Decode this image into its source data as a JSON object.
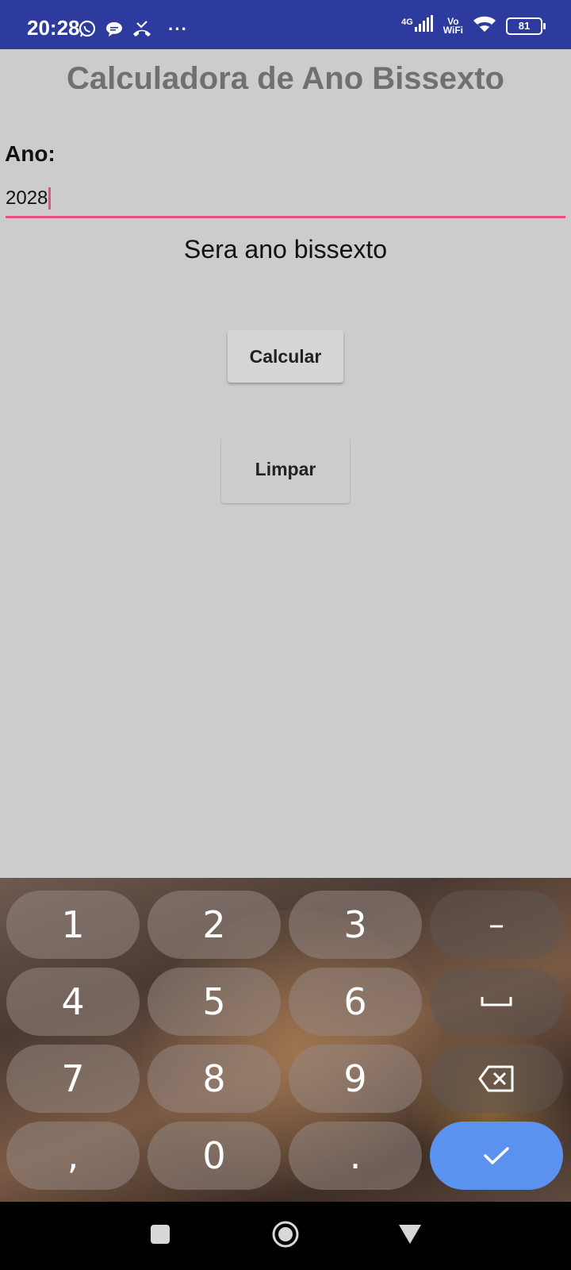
{
  "status_bar": {
    "time": "20:28",
    "network": "4G",
    "vowifi_top": "Vo",
    "vowifi_bottom": "WiFi",
    "battery": "81",
    "more": "···",
    "icons": [
      "whatsapp-icon",
      "chat-bubble-icon",
      "missed-call-icon",
      "signal-icon",
      "wifi-icon",
      "battery-icon"
    ]
  },
  "app": {
    "title": "Calculadora de Ano Bissexto",
    "year_label": "Ano:",
    "year_value": "2028",
    "result": "Sera ano bissexto",
    "calculate_label": "Calcular",
    "clear_label": "Limpar",
    "accent_color": "#e94f86"
  },
  "keyboard": {
    "rows": [
      [
        "1",
        "2",
        "3",
        "–"
      ],
      [
        "4",
        "5",
        "6",
        "space"
      ],
      [
        "7",
        "8",
        "9",
        "backspace"
      ],
      [
        ",",
        "0",
        ".",
        "enter"
      ]
    ],
    "enter_color": "#5b92f0"
  },
  "nav_bar": {
    "items": [
      "recent-apps-icon",
      "home-icon",
      "back-icon"
    ]
  }
}
